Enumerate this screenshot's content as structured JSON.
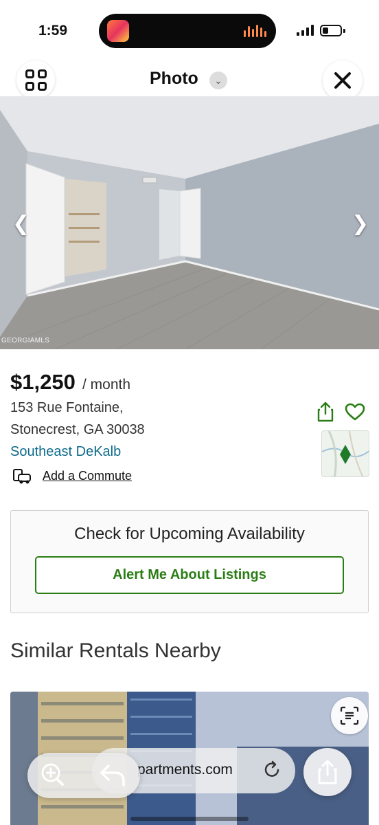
{
  "status_bar": {
    "time": "1:59",
    "battery_level": 0.35
  },
  "photo_header": {
    "title": "Photo",
    "grid_icon": "grid-icon",
    "close_icon": "close-icon",
    "chevron_icon": "chevron-down-icon"
  },
  "photo": {
    "prev_icon": "chevron-left-icon",
    "next_icon": "chevron-right-icon",
    "watermark": "GEORGIAMLS"
  },
  "listing": {
    "price": "$1,250",
    "per": "/ month",
    "address_line1": "153 Rue Fontaine,",
    "address_line2": "Stonecrest, GA 30038",
    "neighborhood": "Southeast DeKalb",
    "commute_label": "Add a Commute",
    "accent_color": "#2a7d14",
    "link_color": "#0e6b8c"
  },
  "availability": {
    "title": "Check for Upcoming Availability",
    "button_label": "Alert Me About Listings"
  },
  "similar": {
    "heading": "Similar Rentals Nearby"
  },
  "browser": {
    "url": "partments.com",
    "icons": [
      "zoom-in-icon",
      "back-icon",
      "reload-icon",
      "share-icon"
    ]
  }
}
